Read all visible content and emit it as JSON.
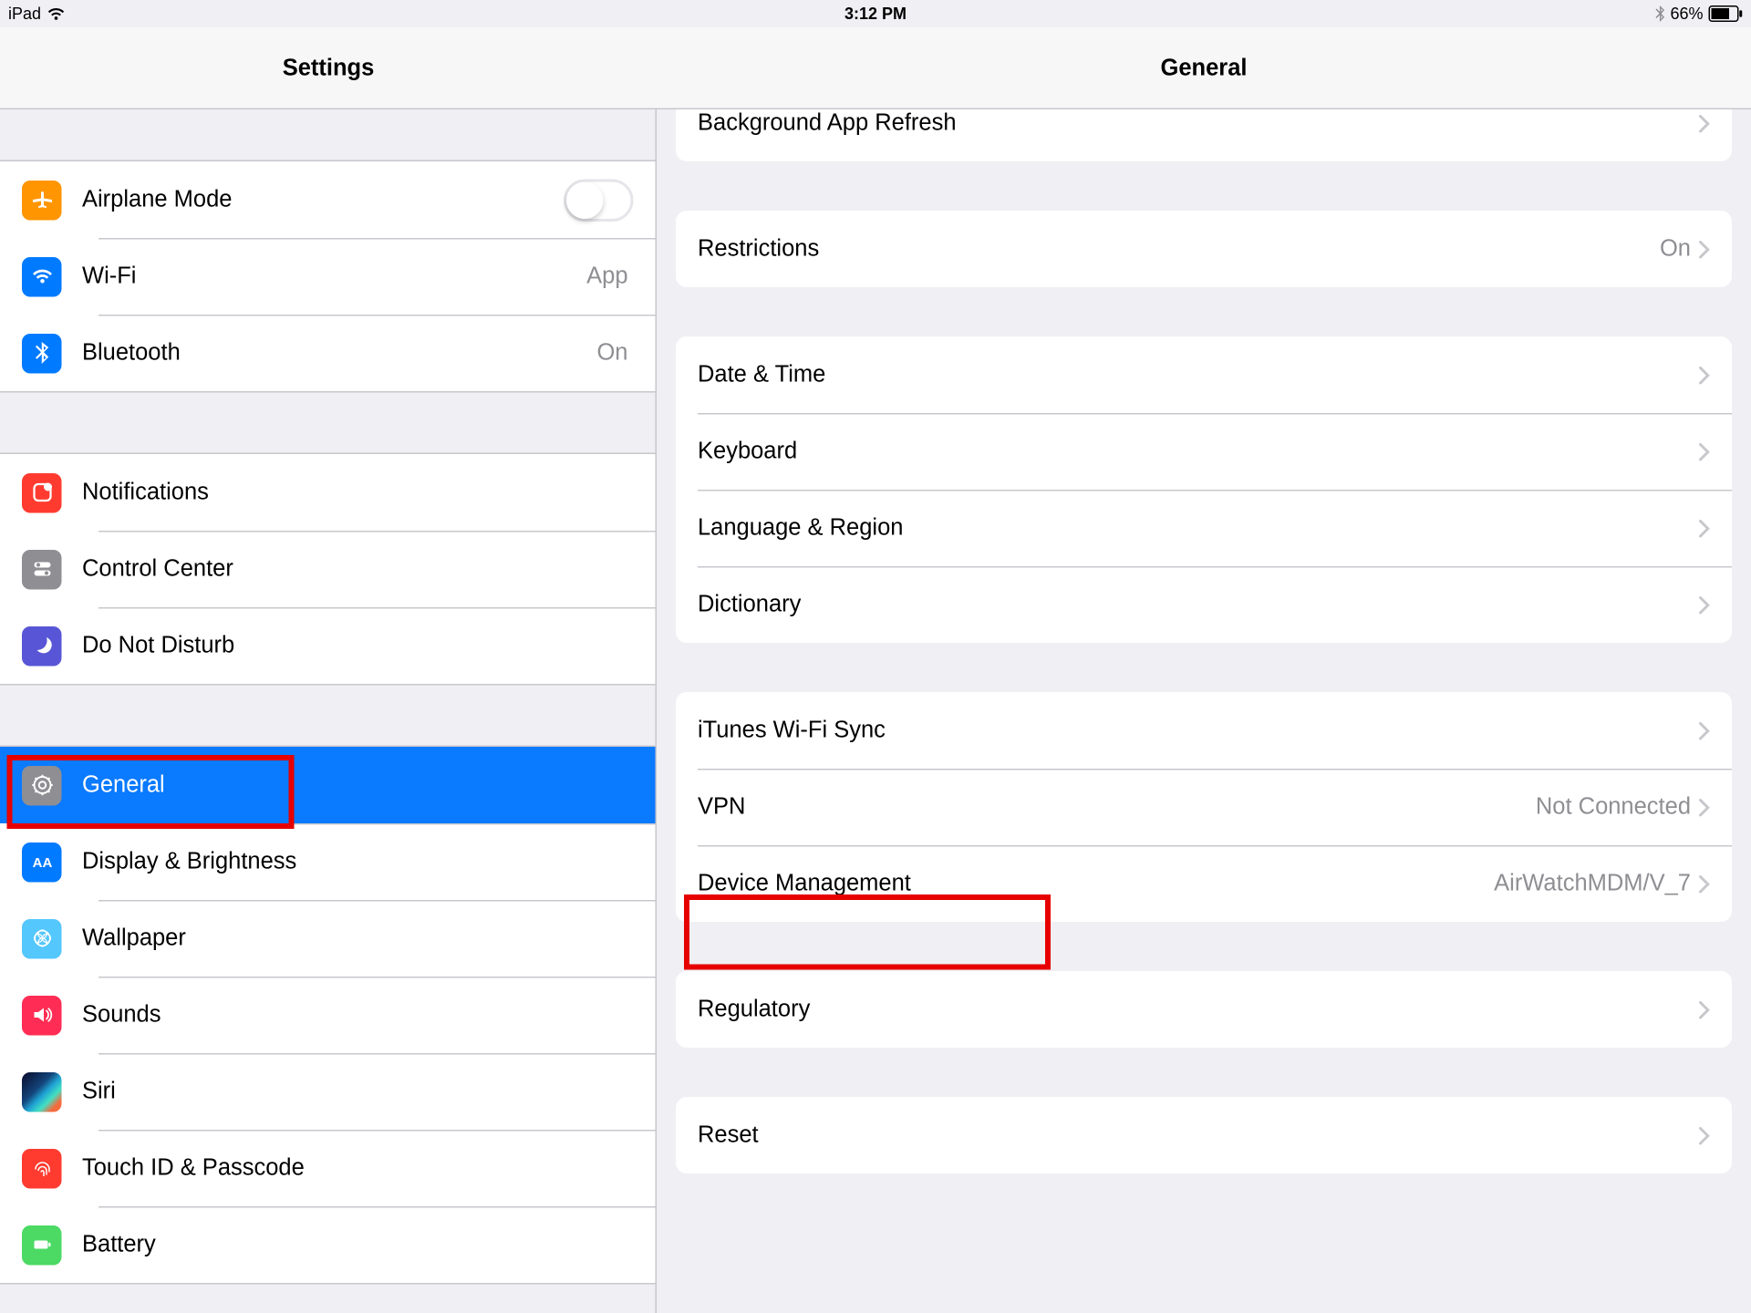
{
  "statusbar": {
    "device": "iPad",
    "time": "3:12 PM",
    "battery_pct": "66%"
  },
  "nav": {
    "left_title": "Settings",
    "right_title": "General"
  },
  "sidebar": {
    "groups": [
      {
        "items": [
          {
            "key": "airplane",
            "label": "Airplane Mode",
            "toggle": false
          },
          {
            "key": "wifi",
            "label": "Wi-Fi",
            "value": "App"
          },
          {
            "key": "bluetooth",
            "label": "Bluetooth",
            "value": "On"
          }
        ]
      },
      {
        "items": [
          {
            "key": "notifications",
            "label": "Notifications"
          },
          {
            "key": "control-center",
            "label": "Control Center"
          },
          {
            "key": "dnd",
            "label": "Do Not Disturb"
          }
        ]
      },
      {
        "items": [
          {
            "key": "general",
            "label": "General",
            "selected": true
          },
          {
            "key": "display",
            "label": "Display & Brightness"
          },
          {
            "key": "wallpaper",
            "label": "Wallpaper"
          },
          {
            "key": "sounds",
            "label": "Sounds"
          },
          {
            "key": "siri",
            "label": "Siri"
          },
          {
            "key": "touchid",
            "label": "Touch ID & Passcode"
          },
          {
            "key": "battery",
            "label": "Battery"
          }
        ]
      }
    ]
  },
  "detail": {
    "groups": [
      [
        {
          "key": "bg-app-refresh",
          "label": "Background App Refresh"
        }
      ],
      [
        {
          "key": "restrictions",
          "label": "Restrictions",
          "value": "On"
        }
      ],
      [
        {
          "key": "date-time",
          "label": "Date & Time"
        },
        {
          "key": "keyboard",
          "label": "Keyboard"
        },
        {
          "key": "lang-region",
          "label": "Language & Region"
        },
        {
          "key": "dictionary",
          "label": "Dictionary"
        }
      ],
      [
        {
          "key": "itunes-wifi-sync",
          "label": "iTunes Wi-Fi Sync"
        },
        {
          "key": "vpn",
          "label": "VPN",
          "value": "Not Connected"
        },
        {
          "key": "device-mgmt",
          "label": "Device Management",
          "value": "AirWatchMDM/V_7"
        }
      ],
      [
        {
          "key": "regulatory",
          "label": "Regulatory"
        }
      ],
      [
        {
          "key": "reset",
          "label": "Reset"
        }
      ]
    ]
  },
  "highlights": {
    "general": true,
    "device_mgmt": true
  }
}
